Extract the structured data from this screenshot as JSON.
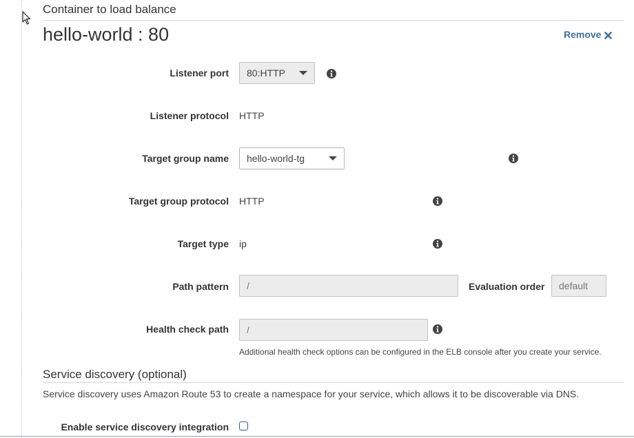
{
  "load_balance": {
    "section_title": "Container to load balance",
    "container_name": "hello-world : 80",
    "remove_label": "Remove",
    "fields": {
      "listener_port": {
        "label": "Listener port",
        "value": "80:HTTP"
      },
      "listener_protocol": {
        "label": "Listener protocol",
        "value": "HTTP"
      },
      "target_group_name": {
        "label": "Target group name",
        "value": "hello-world-tg"
      },
      "target_group_protocol": {
        "label": "Target group protocol",
        "value": "HTTP"
      },
      "target_type": {
        "label": "Target type",
        "value": "ip"
      },
      "path_pattern": {
        "label": "Path pattern",
        "value": "/"
      },
      "evaluation_order": {
        "label": "Evaluation order",
        "value": "default"
      },
      "health_check_path": {
        "label": "Health check path",
        "value": "/",
        "help": "Additional health check options can be configured in the ELB console after you create your service."
      }
    }
  },
  "service_discovery": {
    "section_title": "Service discovery (optional)",
    "description": "Service discovery uses Amazon Route 53 to create a namespace for your service, which allows it to be discoverable via DNS.",
    "enable_label": "Enable service discovery integration",
    "enabled": false
  },
  "icons": {
    "info": "info-icon",
    "remove": "close-icon",
    "dropdown": "caret-down-icon",
    "cursor": "mouse-pointer-icon"
  },
  "colors": {
    "link": "#3f6d9a",
    "info_icon": "#444444",
    "disabled_field": "#ececec"
  }
}
